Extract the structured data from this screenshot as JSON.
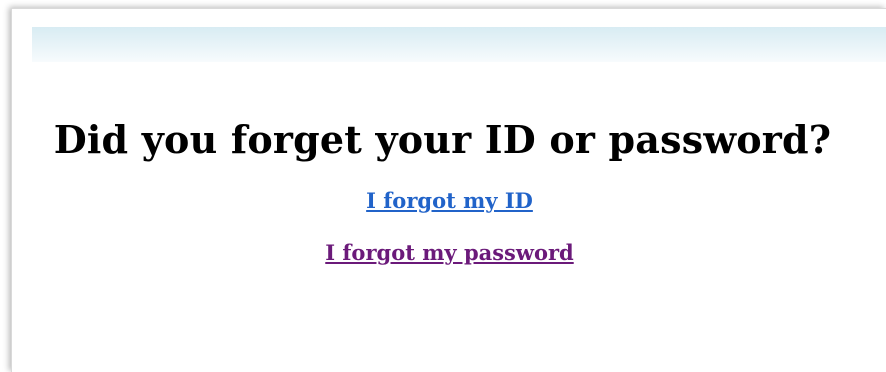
{
  "page": {
    "title": "Did you forget your ID or password?"
  },
  "links": {
    "forgot_id": "I forgot my ID",
    "forgot_password": "I forgot my password"
  },
  "colors": {
    "link_unvisited": "#2163c9",
    "link_visited": "#6b1a7a",
    "header_band": "#d8ecf3"
  }
}
